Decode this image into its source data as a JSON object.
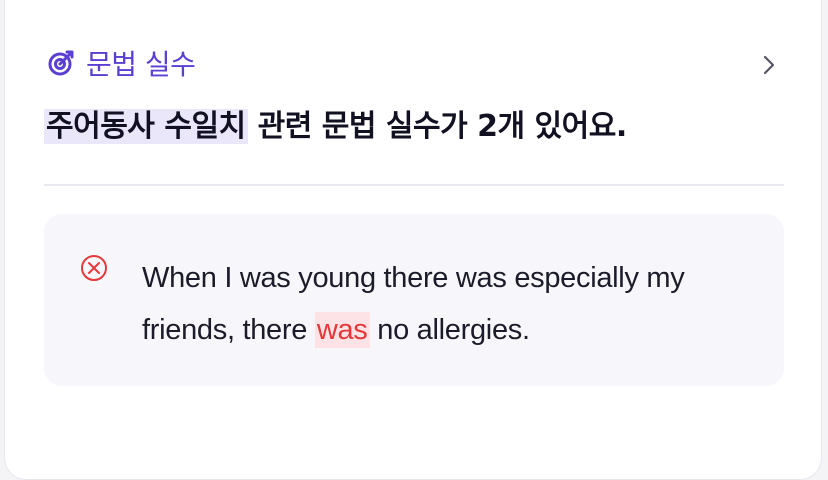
{
  "header": {
    "icon": "target-dart-icon",
    "label": "문법 실수",
    "accent_color": "#5b3fd2",
    "chevron_icon": "chevron-right-icon"
  },
  "title": {
    "highlight": "주어동사 수일치",
    "rest": " 관련 문법 실수가 2개 있어요."
  },
  "example": {
    "icon": "error-x-circle-icon",
    "error_color": "#e5383b",
    "sentence_before": "When I was young there was especially my friends, there ",
    "error_word": "was",
    "sentence_after": " no allergies."
  }
}
